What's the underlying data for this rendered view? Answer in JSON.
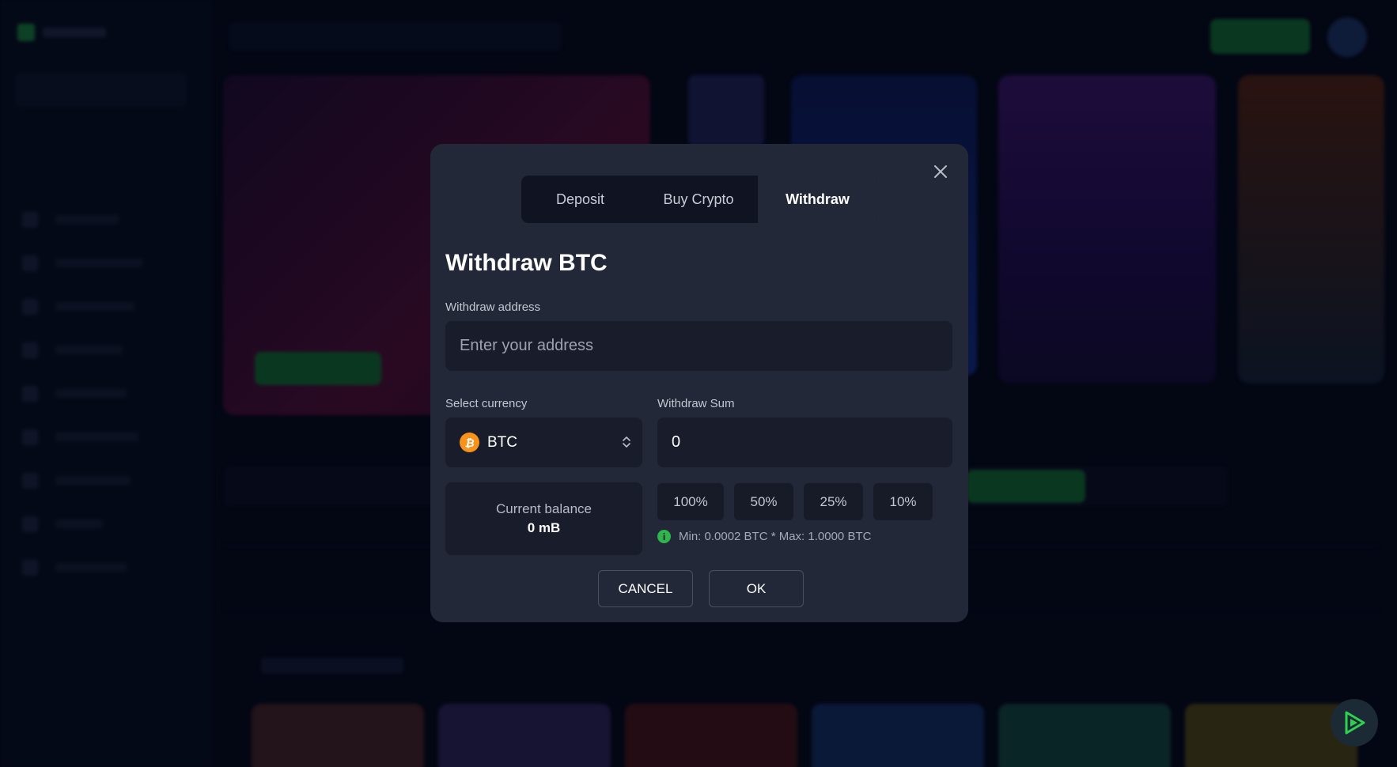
{
  "modal": {
    "tabs": [
      {
        "label": "Deposit",
        "active": false
      },
      {
        "label": "Buy Crypto",
        "active": false
      },
      {
        "label": "Withdraw",
        "active": true
      }
    ],
    "title": "Withdraw BTC",
    "address": {
      "label": "Withdraw address",
      "placeholder": "Enter your address",
      "value": ""
    },
    "currency": {
      "label": "Select currency",
      "selected": "BTC",
      "coin_symbol": "₿"
    },
    "sum": {
      "label": "Withdraw Sum",
      "value": "0"
    },
    "balance": {
      "label": "Current balance",
      "value": "0 mB"
    },
    "percent_buttons": [
      "100%",
      "50%",
      "25%",
      "10%"
    ],
    "limits": "Min: 0.0002 BTC * Max: 1.0000 BTC",
    "cancel_label": "CANCEL",
    "ok_label": "OK"
  },
  "colors": {
    "modal_bg": "#232839",
    "field_bg": "#191d2b",
    "btc_orange": "#f7931a",
    "info_green": "#2fb54d",
    "fab_green": "#2fd24f"
  },
  "icons": {
    "close": "close-icon",
    "select_arrows": "chevron-updown-icon",
    "info": "info-icon",
    "fab": "play-icon"
  }
}
